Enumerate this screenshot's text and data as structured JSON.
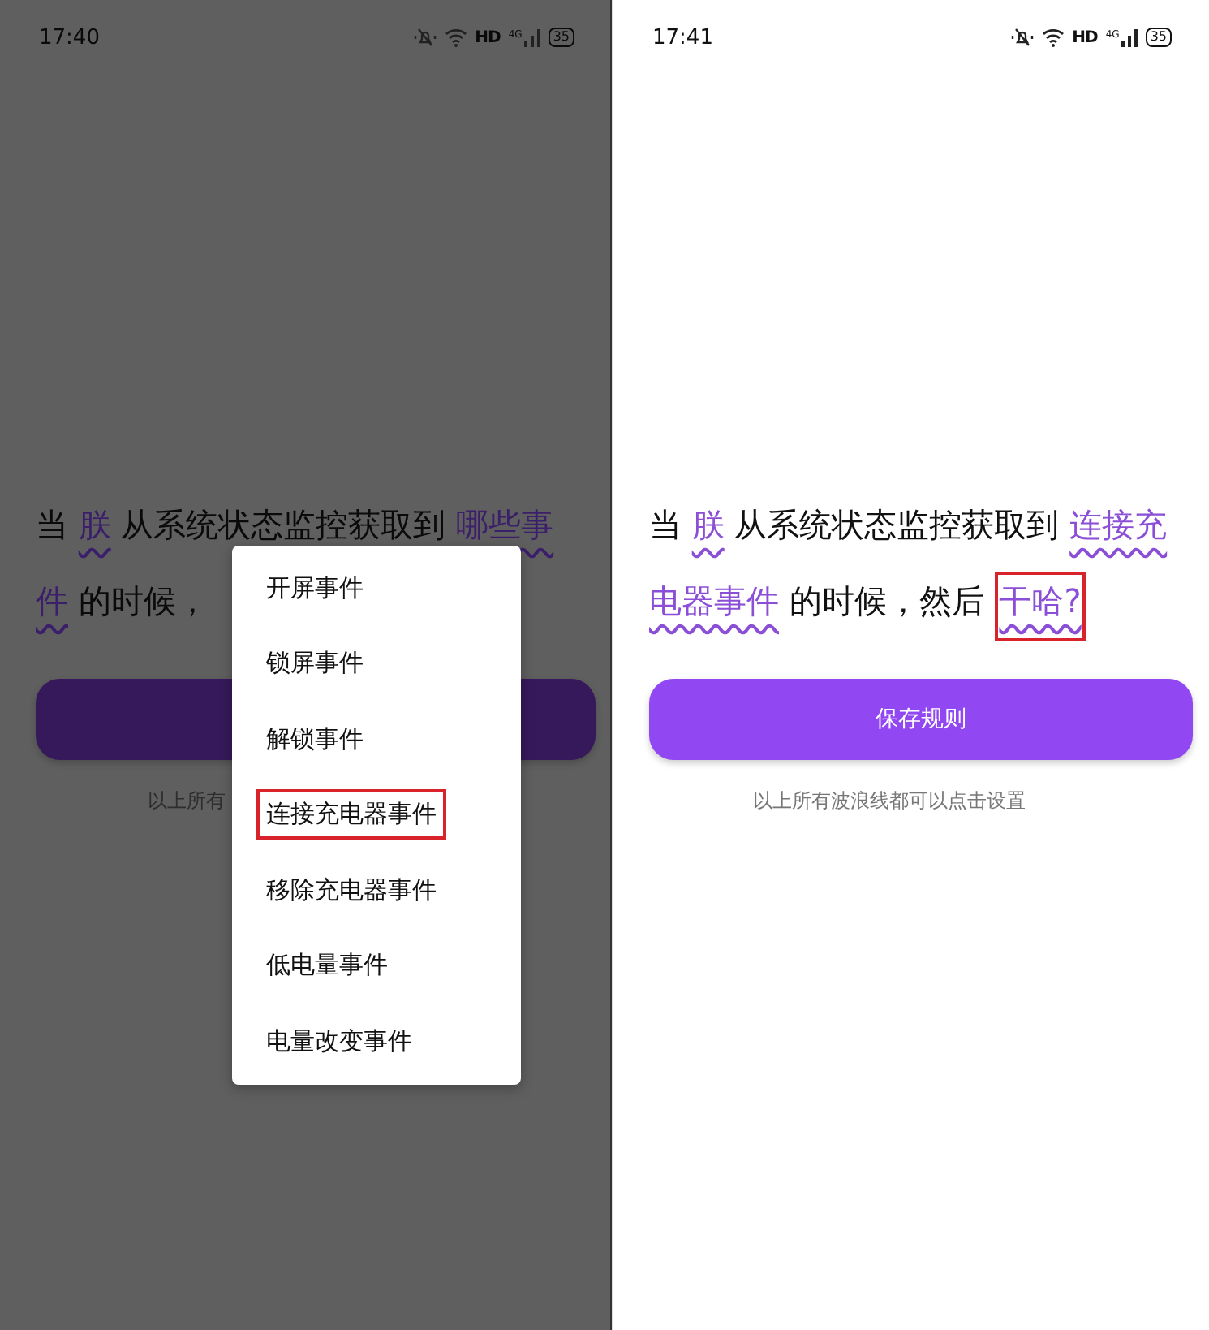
{
  "panels": [
    {
      "dimmed": true,
      "status_bar": {
        "time": "17:40",
        "hd": "HD",
        "network": "4G",
        "battery": "35"
      },
      "sentence_lines": [
        [
          {
            "kind": "plain",
            "text": "当"
          },
          {
            "kind": "choice",
            "text": "朕",
            "highlighted": false
          },
          {
            "kind": "plain",
            "text": "从系统状态监控获取到"
          },
          {
            "kind": "choice",
            "text": "哪些事",
            "highlighted": false
          }
        ],
        [
          {
            "kind": "choice",
            "text": "件",
            "highlighted": false
          },
          {
            "kind": "plain",
            "text": "的时候，"
          }
        ]
      ],
      "hint": "以上所有",
      "menu": [
        {
          "label": "开屏事件",
          "highlighted": false
        },
        {
          "label": "锁屏事件",
          "highlighted": false
        },
        {
          "label": "解锁事件",
          "highlighted": false
        },
        {
          "label": "连接充电器事件",
          "highlighted": true
        },
        {
          "label": "移除充电器事件",
          "highlighted": false
        },
        {
          "label": "低电量事件",
          "highlighted": false
        },
        {
          "label": "电量改变事件",
          "highlighted": false
        }
      ]
    },
    {
      "dimmed": false,
      "status_bar": {
        "time": "17:41",
        "hd": "HD",
        "network": "4G",
        "battery": "35"
      },
      "sentence_lines": [
        [
          {
            "kind": "plain",
            "text": "当"
          },
          {
            "kind": "choice",
            "text": "朕",
            "highlighted": false
          },
          {
            "kind": "plain",
            "text": "从系统状态监控获取到"
          },
          {
            "kind": "choice",
            "text": "连接充",
            "highlighted": false
          }
        ],
        [
          {
            "kind": "choice",
            "text": "电器事件",
            "highlighted": false
          },
          {
            "kind": "plain",
            "text": "的时候，然后"
          },
          {
            "kind": "choice",
            "text": "干哈?",
            "highlighted": true
          }
        ]
      ],
      "save_button": "保存规则",
      "hint": "以上所有波浪线都可以点击设置"
    }
  ]
}
